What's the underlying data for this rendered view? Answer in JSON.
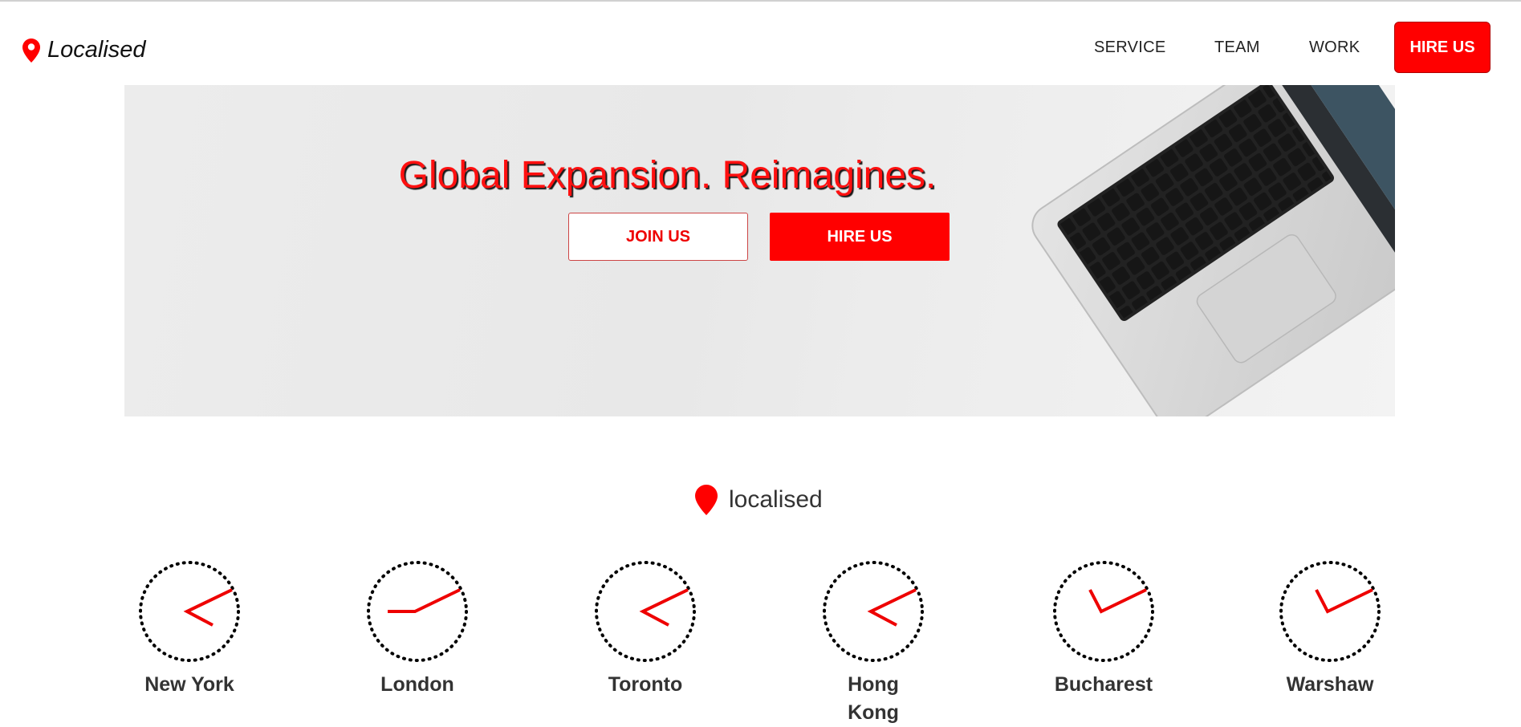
{
  "brand": {
    "name": "Localised",
    "icon": "map-pin-icon",
    "color": "#ff0000"
  },
  "nav": {
    "items": [
      {
        "label": "SERVICE"
      },
      {
        "label": "TEAM"
      },
      {
        "label": "WORK"
      }
    ],
    "cta_label": "HIRE US"
  },
  "hero": {
    "title": "Global Expansion. Reimagines.",
    "join_label": "JOIN US",
    "hire_label": "HIRE US",
    "image": "laptop-keyboard-image"
  },
  "section": {
    "logo_text": "localised",
    "icon": "map-pin-icon"
  },
  "clocks": [
    {
      "city": "New York",
      "icon": "clock-icon"
    },
    {
      "city": "London",
      "icon": "clock-icon"
    },
    {
      "city": "Toronto",
      "icon": "clock-icon"
    },
    {
      "city": "Hong Kong",
      "icon": "clock-icon"
    },
    {
      "city": "Bucharest",
      "icon": "clock-icon"
    },
    {
      "city": "Warshaw",
      "icon": "clock-icon"
    }
  ],
  "colors": {
    "accent": "#ff0000",
    "text": "#333333",
    "hero_bg": "#ebebeb"
  }
}
